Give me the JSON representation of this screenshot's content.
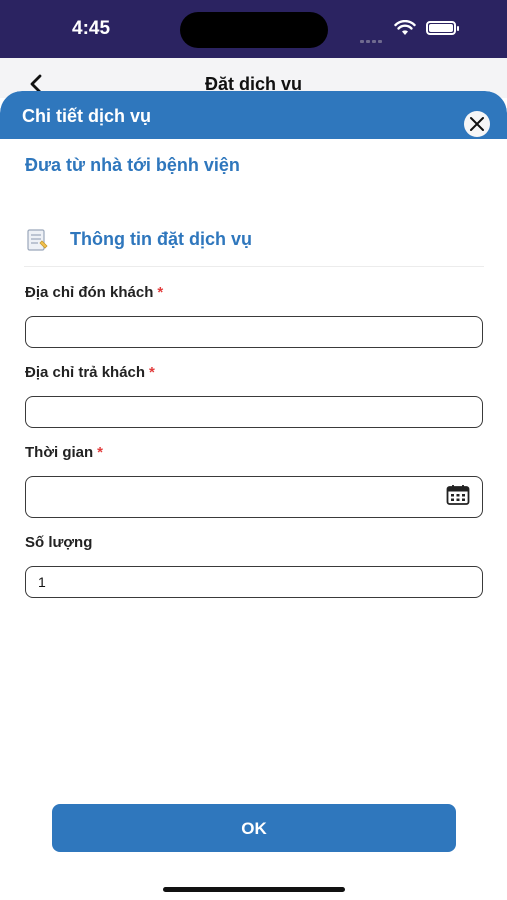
{
  "status_bar": {
    "time": "4:45"
  },
  "page": {
    "title": "Đặt dịch vụ"
  },
  "modal": {
    "title": "Chi tiết dịch vụ",
    "service_name": "Đưa từ nhà tới bệnh viện",
    "section_title": "Thông tin đặt dịch vụ",
    "fields": [
      {
        "label": "Địa chỉ đón khách",
        "required": "*",
        "value": ""
      },
      {
        "label": "Địa chỉ trả khách",
        "required": "*",
        "value": ""
      },
      {
        "label": "Thời gian",
        "required": "*",
        "value": ""
      },
      {
        "label": "Số lượng",
        "value": "1"
      }
    ],
    "ok_label": "OK"
  },
  "colors": {
    "status_bar": "#2b2361",
    "accent": "#2f77bd",
    "required": "#e23b3b"
  },
  "icons": {
    "back": "chevron-left-icon",
    "close": "close-icon",
    "section": "document-icon",
    "calendar": "calendar-icon"
  }
}
